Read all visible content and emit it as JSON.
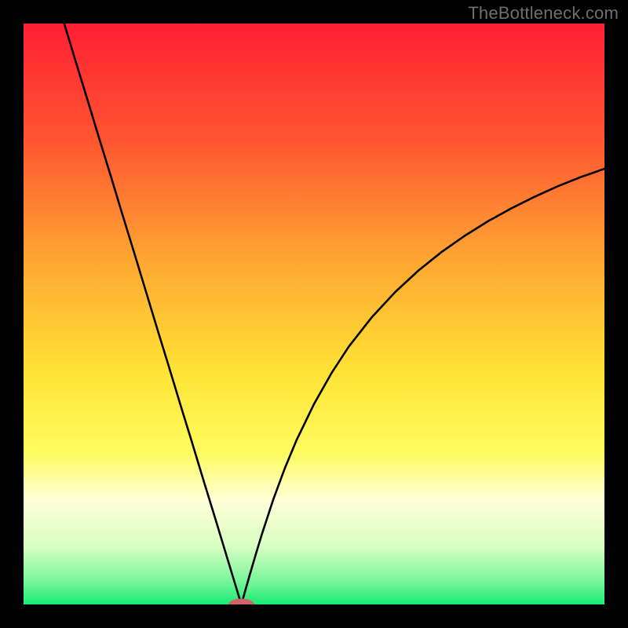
{
  "watermark": "TheBottleneck.com",
  "chart_data": {
    "type": "line",
    "title": "",
    "xlabel": "",
    "ylabel": "",
    "xlim": [
      0,
      100
    ],
    "ylim": [
      0,
      100
    ],
    "grid": false,
    "legend": false,
    "background_gradient": {
      "stops": [
        {
          "offset": 0.0,
          "color": "#ff1f33"
        },
        {
          "offset": 0.2,
          "color": "#ff5531"
        },
        {
          "offset": 0.4,
          "color": "#ffa432"
        },
        {
          "offset": 0.6,
          "color": "#ffe335"
        },
        {
          "offset": 0.74,
          "color": "#fffc60"
        },
        {
          "offset": 0.82,
          "color": "#ffffd8"
        },
        {
          "offset": 0.9,
          "color": "#d8ffc3"
        },
        {
          "offset": 0.96,
          "color": "#7af59c"
        },
        {
          "offset": 1.0,
          "color": "#18ec74"
        }
      ]
    },
    "series": [
      {
        "name": "left-branch",
        "type": "line",
        "color": "#000000",
        "x": [
          7,
          9,
          11,
          13,
          15,
          17,
          19,
          21,
          23,
          25,
          27,
          29,
          31,
          33,
          34,
          35,
          36,
          37,
          37.5
        ],
        "y": [
          100,
          93.4,
          86.9,
          80.3,
          73.8,
          67.2,
          60.7,
          54.1,
          47.5,
          41.0,
          34.4,
          27.9,
          21.3,
          14.8,
          11.5,
          8.2,
          4.9,
          1.6,
          0
        ]
      },
      {
        "name": "right-branch",
        "type": "line",
        "color": "#000000",
        "x": [
          37.5,
          38,
          39,
          40,
          41,
          43,
          45,
          47,
          50,
          53,
          56,
          60,
          64,
          68,
          72,
          76,
          80,
          84,
          88,
          92,
          96,
          100
        ],
        "y": [
          0,
          1.8,
          5.3,
          8.7,
          12.0,
          18.1,
          23.5,
          28.3,
          34.5,
          39.8,
          44.4,
          49.5,
          53.8,
          57.5,
          60.7,
          63.5,
          66.0,
          68.2,
          70.2,
          72.0,
          73.6,
          75.0
        ]
      }
    ],
    "marker": {
      "name": "min-marker",
      "x": 37.5,
      "y": 0,
      "rx": 2.2,
      "ry": 1.0,
      "fill": "#d1636a"
    }
  }
}
